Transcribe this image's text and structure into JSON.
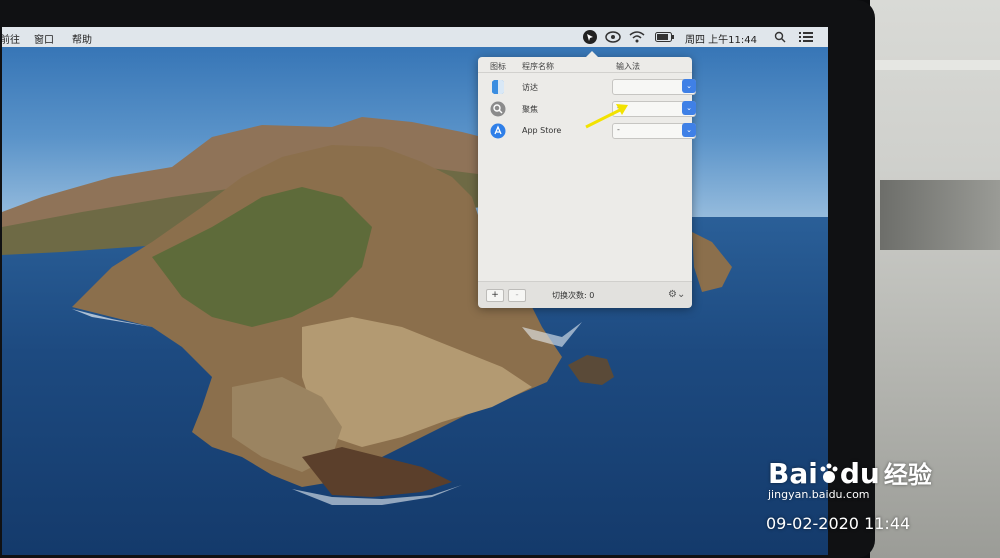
{
  "menubar": {
    "left_items": [
      "前往",
      "窗口",
      "帮助"
    ],
    "clock": "周四 上午11:44",
    "icons": [
      "app-status-icon",
      "creative-cloud-icon",
      "wifi-icon",
      "battery-icon",
      "spotlight-search-icon",
      "notification-center-icon"
    ]
  },
  "popover": {
    "headers": {
      "icon": "图标",
      "name": "程序名称",
      "input": "输入法"
    },
    "rows": [
      {
        "icon": "finder-icon",
        "name": "访达",
        "value": ""
      },
      {
        "icon": "spotlight-app-icon",
        "name": "聚焦",
        "value": "-"
      },
      {
        "icon": "app-store-icon",
        "name": "App Store",
        "value": "-"
      }
    ],
    "footer": {
      "add": "+",
      "remove": "-",
      "switch_count": "切换次数: 0"
    }
  },
  "watermark": {
    "brand": "Bai",
    "brand2": "du",
    "cn": "经验",
    "domain": "jingyan.baidu.com"
  },
  "photo_stamp": "09-02-2020 11:44",
  "colors": {
    "accent": "#3f80e6",
    "annotation_arrow": "#f2e200"
  }
}
